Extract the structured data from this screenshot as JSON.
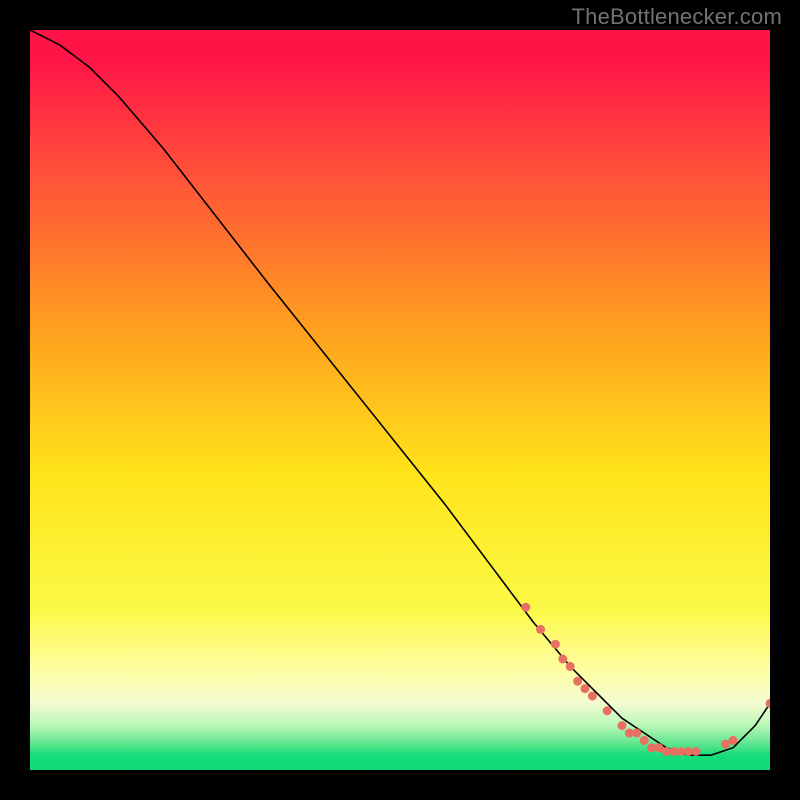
{
  "watermark": "TheBottlenecker.com",
  "chart_data": {
    "type": "line",
    "title": "",
    "xlabel": "",
    "ylabel": "",
    "xlim": [
      0,
      100
    ],
    "ylim": [
      0,
      100
    ],
    "series": [
      {
        "name": "curve",
        "x": [
          0,
          4,
          8,
          12,
          18,
          25,
          32,
          40,
          48,
          56,
          62,
          68,
          73,
          77,
          80,
          83,
          86,
          89,
          92,
          95,
          98,
          100
        ],
        "y": [
          100,
          98,
          95,
          91,
          84,
          75,
          66,
          56,
          46,
          36,
          28,
          20,
          14,
          10,
          7,
          5,
          3,
          2,
          2,
          3,
          6,
          9
        ]
      }
    ],
    "markers": {
      "name": "highlight-dots",
      "color": "#e77063",
      "x": [
        67,
        69,
        71,
        72,
        73,
        74,
        75,
        76,
        78,
        80,
        81,
        82,
        83,
        84,
        85,
        86,
        87,
        88,
        89,
        90,
        94,
        95,
        100
      ],
      "y": [
        22,
        19,
        17,
        15,
        14,
        12,
        11,
        10,
        8,
        6,
        5,
        5,
        4,
        3,
        3,
        2.5,
        2.5,
        2.5,
        2.5,
        2.5,
        3.5,
        4,
        9
      ]
    }
  }
}
